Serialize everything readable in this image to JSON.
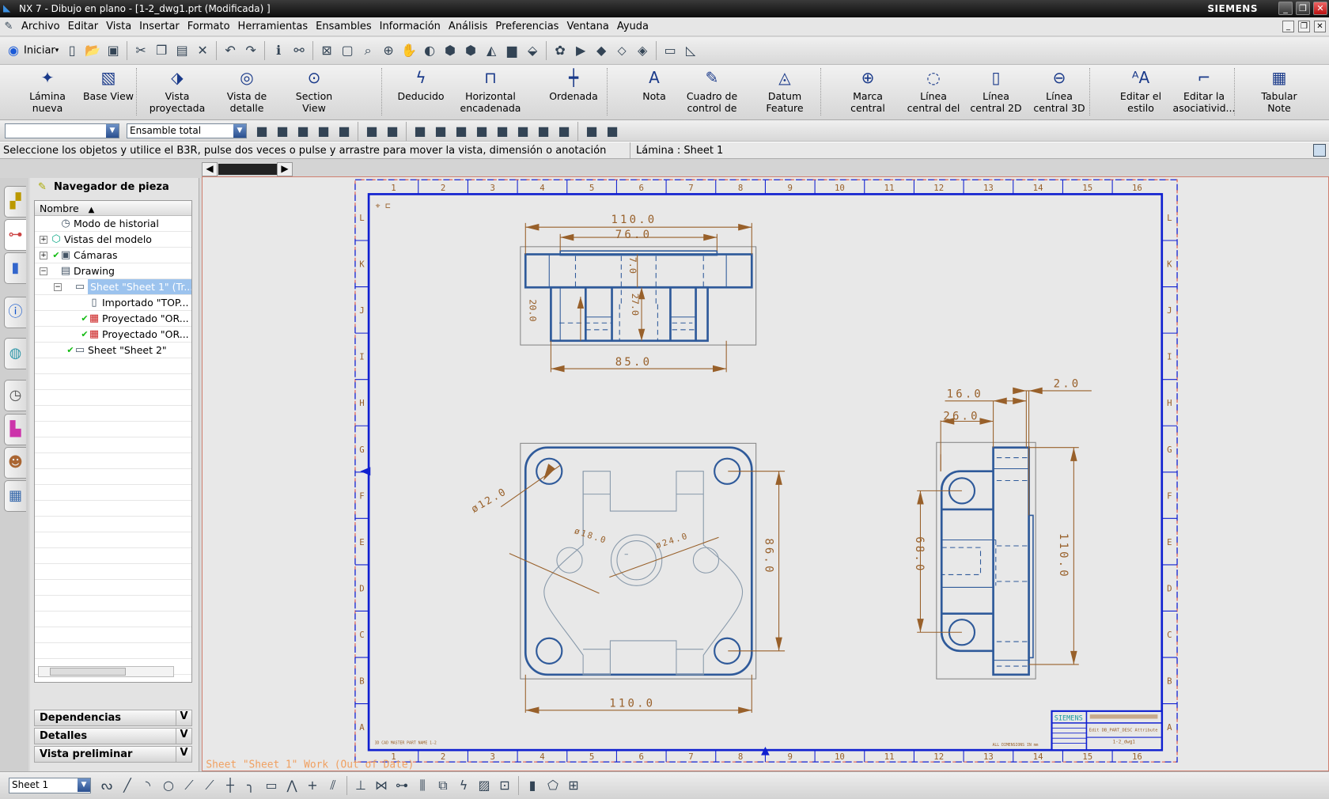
{
  "window": {
    "title": "NX 7 - Dibujo en plano - [1-2_dwg1.prt (Modificada) ]",
    "brand": "SIEMENS"
  },
  "menu": [
    "Archivo",
    "Editar",
    "Vista",
    "Insertar",
    "Formato",
    "Herramientas",
    "Ensambles",
    "Información",
    "Análisis",
    "Preferencias",
    "Ventana",
    "Ayuda"
  ],
  "toolbar1": {
    "start_label": "Iniciar",
    "icons": [
      "new-file",
      "open-folder",
      "save",
      "cut",
      "copy",
      "paste",
      "delete",
      "undo",
      "redo",
      "info",
      "binoculars",
      "fit",
      "zoom-window",
      "zoom-box",
      "zoom-in",
      "pan",
      "shaded",
      "wireframe",
      "hidden",
      "shaded-edges",
      "background",
      "view-triad",
      "paint",
      "play",
      "move",
      "select",
      "replace",
      "measure-distance",
      "measure-angle"
    ]
  },
  "ribbon": [
    {
      "label": "Lámina\nnueva",
      "icon": "new-sheet"
    },
    {
      "label": "Base View",
      "icon": "base-view"
    },
    {
      "label": "Vista\nproyectada",
      "icon": "projected-view"
    },
    {
      "label": "Vista de\ndetalle",
      "icon": "detail-view"
    },
    {
      "label": "Section\nView",
      "icon": "section-view"
    },
    {
      "label": "Deducido",
      "icon": "inferred-dimension"
    },
    {
      "label": "Horizontal\nencadenada",
      "icon": "chain-dimension"
    },
    {
      "label": "Ordenada",
      "icon": "ordinate-dimension"
    },
    {
      "label": "Nota",
      "icon": "note"
    },
    {
      "label": "Cuadro de\ncontrol de",
      "icon": "feature-control-frame"
    },
    {
      "label": "Datum\nFeature",
      "icon": "datum-feature"
    },
    {
      "label": "Marca\ncentral",
      "icon": "center-mark"
    },
    {
      "label": "Línea\ncentral del",
      "icon": "bolt-circle-centerline"
    },
    {
      "label": "Línea\ncentral 2D",
      "icon": "centerline-2d"
    },
    {
      "label": "Línea\ncentral 3D",
      "icon": "centerline-3d"
    },
    {
      "label": "Editar el\nestilo",
      "icon": "edit-style"
    },
    {
      "label": "Editar la\nasociativid...",
      "icon": "edit-associativity"
    },
    {
      "label": "Tabular\nNote",
      "icon": "tabular-note"
    }
  ],
  "toolbar3": {
    "filter_value": "",
    "assembly_value": "Ensamble total"
  },
  "status": {
    "prompt": "Seleccione los objetos y utilice el B3R, pulse dos veces o pulse y arrastre para mover la vista, dimensión o anotación",
    "sheet": "Lámina : Sheet 1"
  },
  "navigator": {
    "title": "Navegador de pieza",
    "column": "Nombre",
    "items": [
      {
        "label": "Modo de historial",
        "level": 0,
        "expander": "",
        "check": false,
        "icon": "clock"
      },
      {
        "label": "Vistas del modelo",
        "level": 0,
        "expander": "+",
        "check": false,
        "icon": "model-views"
      },
      {
        "label": "Cámaras",
        "level": 0,
        "expander": "+",
        "check": true,
        "icon": "cameras"
      },
      {
        "label": "Drawing",
        "level": 0,
        "expander": "−",
        "check": false,
        "icon": "drawing"
      },
      {
        "label": "Sheet \"Sheet 1\" (Tr...",
        "level": 1,
        "expander": "−",
        "check": false,
        "icon": "sheet",
        "selected": true
      },
      {
        "label": "Importado \"TOP...",
        "level": 2,
        "expander": "",
        "check": false,
        "icon": "imported-view"
      },
      {
        "label": "Proyectado \"OR...",
        "level": 2,
        "expander": "",
        "check": true,
        "icon": "projected-view"
      },
      {
        "label": "Proyectado \"OR...",
        "level": 2,
        "expander": "",
        "check": true,
        "icon": "projected-view"
      },
      {
        "label": "Sheet \"Sheet 2\"",
        "level": 1,
        "expander": "",
        "check": true,
        "icon": "sheet"
      }
    ],
    "panels": [
      "Dependencias",
      "Detalles",
      "Vista preliminar"
    ]
  },
  "drawing": {
    "caption": "Sheet \"Sheet 1\" Work (Out of Date)",
    "zones_x": [
      "1",
      "2",
      "3",
      "4",
      "5",
      "6",
      "7",
      "8",
      "9",
      "10",
      "11",
      "12",
      "13",
      "14",
      "15",
      "16"
    ],
    "zones_y": [
      "L",
      "K",
      "J",
      "I",
      "H",
      "G",
      "F",
      "E",
      "D",
      "C",
      "B",
      "A"
    ],
    "dims": {
      "front_width": "110.0",
      "front_boss": "76.0",
      "front_base": "85.0",
      "front_v1": "7.0",
      "front_v2": "27.0",
      "front_v3": "20.0",
      "plan_width": "110.0",
      "plan_hole_spacing": "86.0",
      "plan_hole_dia": "ø12.0",
      "plan_dia18": "ø18.0",
      "plan_dia24": "ø24.0",
      "side_16": "16.0",
      "side_26": "26.0",
      "side_2": "2.0",
      "side_68": "68.0",
      "side_110": "110.0"
    },
    "notes": {
      "left": "3D CAD MASTER PART NAME 1-2",
      "right": "ALL DIMENSIONS IN mm"
    },
    "title_block": {
      "brand": "SIEMENS",
      "desc": "Edit DB_PART_DESC Attribute",
      "dwg": "1-2_dwg1"
    },
    "colors": {
      "geometry": "#2f5a9a",
      "dimension": "#98602a",
      "border": "#0a14c8",
      "hidden": "#8899aa"
    }
  },
  "bottom": {
    "sheet_select": "Sheet 1",
    "icons": [
      "studio-spline",
      "line",
      "arc",
      "circle",
      "trim",
      "extend",
      "split",
      "fillet",
      "rectangle",
      "polyline",
      "point",
      "offset",
      "constraint",
      "symmetric",
      "dimension",
      "mirror",
      "pattern",
      "lightning",
      "hatch",
      "add-point",
      "add-cylinder",
      "outline",
      "pattern-layout"
    ]
  }
}
